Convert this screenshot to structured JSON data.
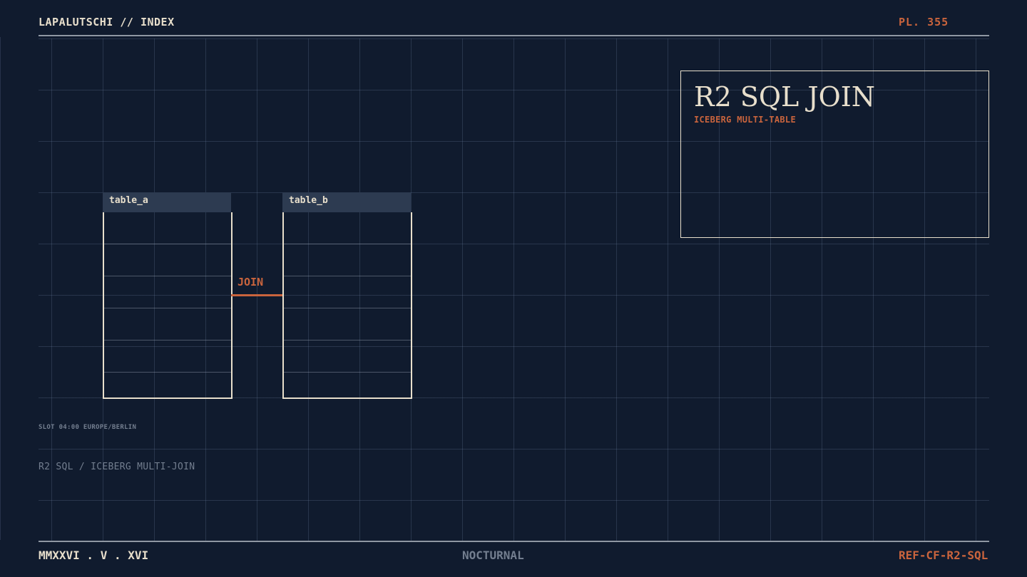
{
  "header": {
    "title": "LAPALUTSCHI // INDEX",
    "plate": "PL. 355"
  },
  "title_card": {
    "title": "R2 SQL JOIN",
    "subtitle": "ICEBERG MULTI-TABLE"
  },
  "diagram": {
    "tables": [
      {
        "name": "table_a"
      },
      {
        "name": "table_b"
      }
    ],
    "join_label": "JOIN"
  },
  "meta": {
    "slot": "SLOT 04:00 EUROPE/BERLIN",
    "caption": "R2 SQL / ICEBERG MULTI-JOIN"
  },
  "footer": {
    "date": "MMXXVI . V . XVI",
    "mode": "NOCTURNAL",
    "ref": "REF-CF-R2-SQL"
  },
  "colors": {
    "background": "#101b2e",
    "ink": "#e8dfcc",
    "accent": "#c9643d",
    "muted": "#737e8f",
    "table_header": "#2d3b51"
  }
}
